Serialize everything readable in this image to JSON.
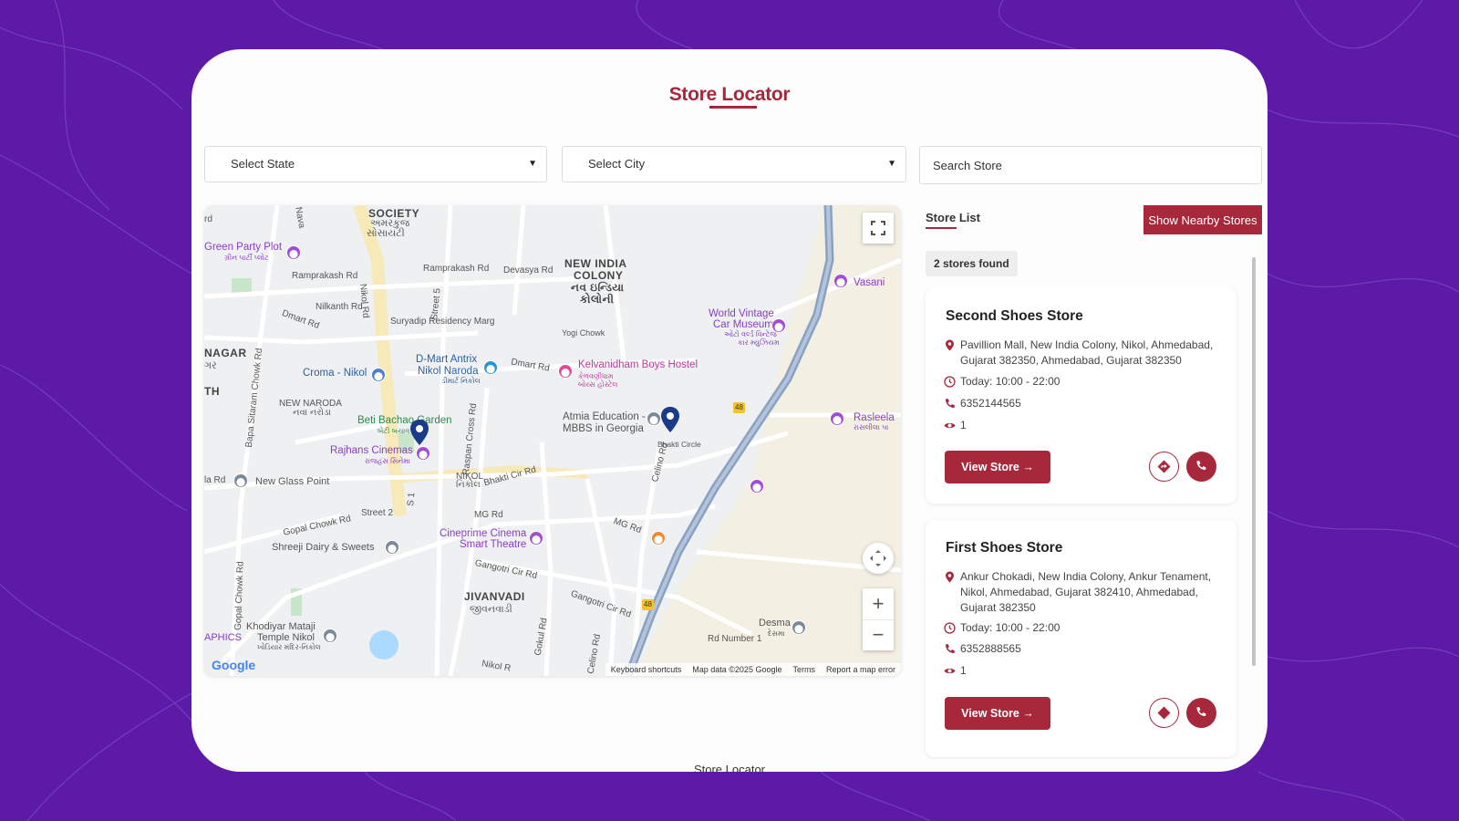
{
  "header": {
    "title": "Store Locator"
  },
  "filters": {
    "state_label": "Select State",
    "city_label": "Select City",
    "search_placeholder": "Search Store"
  },
  "map": {
    "labels": {
      "society": "SOCIETY",
      "society_gu1": "અમરકુંજ",
      "society_gu2": "સોસાયટી",
      "new_india_colony": "NEW INDIA",
      "new_india_colony2": "COLONY",
      "new_india_gu1": "નવ ઇન્ડિયા",
      "new_india_gu2": "કોલોની",
      "nagar": "NAGAR",
      "nagar_gu": "ગર",
      "th": "TH",
      "new_naroda": "NEW NARODA",
      "new_naroda_gu": "નવા નરોડા",
      "nikol": "NIKOL",
      "nikol_gu": "નિકોલ",
      "jivanvadi": "JIVANVADI",
      "jivanvadi_gu": "જીવનવાડી",
      "aphics": "APHICS",
      "green_party_plot": "Green Party Plot",
      "green_party_gu": "ગ્રીન પાર્ટી પ્લોટ",
      "ramprakash_rd": "Ramprakash Rd",
      "ramprakash_rd2": "Ramprakash Rd",
      "devasya_rd": "Devasya Rd",
      "nilkanth_rd": "Nilkanth Rd",
      "suryadip": "Suryadip Residency Marg",
      "dmart_rd": "Dmart Rd",
      "dmart_rd2": "Dmart Rd",
      "yogi_chowk": "Yogi Chowk",
      "croma": "Croma - Nikol",
      "croma_gu": "ક્રોમા",
      "dmart_antrix1": "D-Mart Antrix",
      "dmart_antrix2": "Nikol Naroda",
      "dmart_gu": "ડીમાર્ટ નિકોલ",
      "kelvanidham": "Kelvanidham Boys Hostel",
      "kelvanidham_gu1": "કેળવણીધામ",
      "kelvanidham_gu2": "બોય્સ હોસ્ટેલ",
      "world_vintage1": "World Vintage",
      "world_vintage2": "Car Museum",
      "world_vintage_gu1": "ઓટો વર્લ્ડ વિન્ટેજ",
      "world_vintage_gu2": "કાર મ્યુઝિયમ",
      "vasani": "Vasani",
      "atmia1": "Atmia Education -",
      "atmia2": "MBBS in Georgia",
      "bhakti_circle": "Bhakti Circle",
      "rasleela": "Rasleela",
      "rasleela_gu": "રાસલીલા પા",
      "beti_bachao": "Beti Bachao Garden",
      "beti_bachao_gu": "બેટી બચાવ",
      "rajhans": "Rajhans Cinemas",
      "rajhans_gu": "રાજહંસ સિનેમા",
      "new_glass_point": "New Glass Point",
      "bhakti_cir_rd": "Bhakti Cir Rd",
      "street2": "Street 2",
      "mg_rd": "MG Rd",
      "mg_rd2": "MG Rd",
      "gopal_chowk_rd": "Gopal Chowk Rd",
      "shreeji": "Shreeji Dairy & Sweets",
      "cineprime1": "Cineprime Cinema",
      "cineprime2": "Smart Theatre",
      "gangotri1": "Gangotri Cir Rd",
      "gangotri2": "Gangotri Cir Rd",
      "khodiyar1": "Khodiyar Mataji",
      "khodiyar2": "Temple Nikol",
      "khodiyar_gu": "ખોડિયાર મંદિર-નિકોલ",
      "desma": "Desma",
      "desma_gu": "દેસમા",
      "rd_number1": "Rd Number 1",
      "nikol_rd": "Nikol R",
      "bapa_sitaram": "Bapa Sitaram Chowk Rd",
      "gopal_chowk_rd_v": "Gopal Chowk Rd",
      "raspan": "Raspan Cross Rd",
      "nikol_rd_v": "Nikol Rd",
      "street5": "Street 5",
      "s1": "S 1",
      "gokul_rd": "Gokul Rd",
      "celino_rd": "Celino Rd",
      "celino_rd2": "Celino Rd",
      "nava": "Nava",
      "la_rd": "la Rd",
      "rd": "rd",
      "hwy48": "48",
      "hwy48b": "48"
    },
    "google_logo": "Google",
    "footer": {
      "shortcuts": "Keyboard shortcuts",
      "map_data": "Map data ©2025 Google",
      "terms": "Terms",
      "report": "Report a map error"
    },
    "icons": {
      "fullscreen": "fullscreen-icon",
      "pan": "pan-icon",
      "zoom_in": "+",
      "zoom_out": "−"
    }
  },
  "store_list": {
    "tab_label": "Store List",
    "nearby_button": "Show Nearby Stores",
    "found_text": "2 stores found",
    "stores": [
      {
        "name": "Second Shoes Store",
        "address": "Pavillion Mall, New India Colony, Nikol, Ahmedabad, Gujarat 382350, Ahmedabad, Gujarat 382350",
        "hours": "Today: 10:00 - 22:00",
        "phone": "6352144565",
        "views": "1",
        "view_label": "View Store"
      },
      {
        "name": "First Shoes Store",
        "address": "Ankur Chokadi, New India Colony, Ankur Tenament, Nikol, Ahmedabad, Gujarat 382410, Ahmedabad, Gujarat 382350",
        "hours": "Today: 10:00 - 22:00",
        "phone": "6352888565",
        "views": "1",
        "view_label": "View Store"
      }
    ]
  },
  "footer": {
    "text": "Store Locator"
  },
  "colors": {
    "background": "#5d1aa6",
    "brand": "#a7283a",
    "card": "#fdfdfd"
  }
}
